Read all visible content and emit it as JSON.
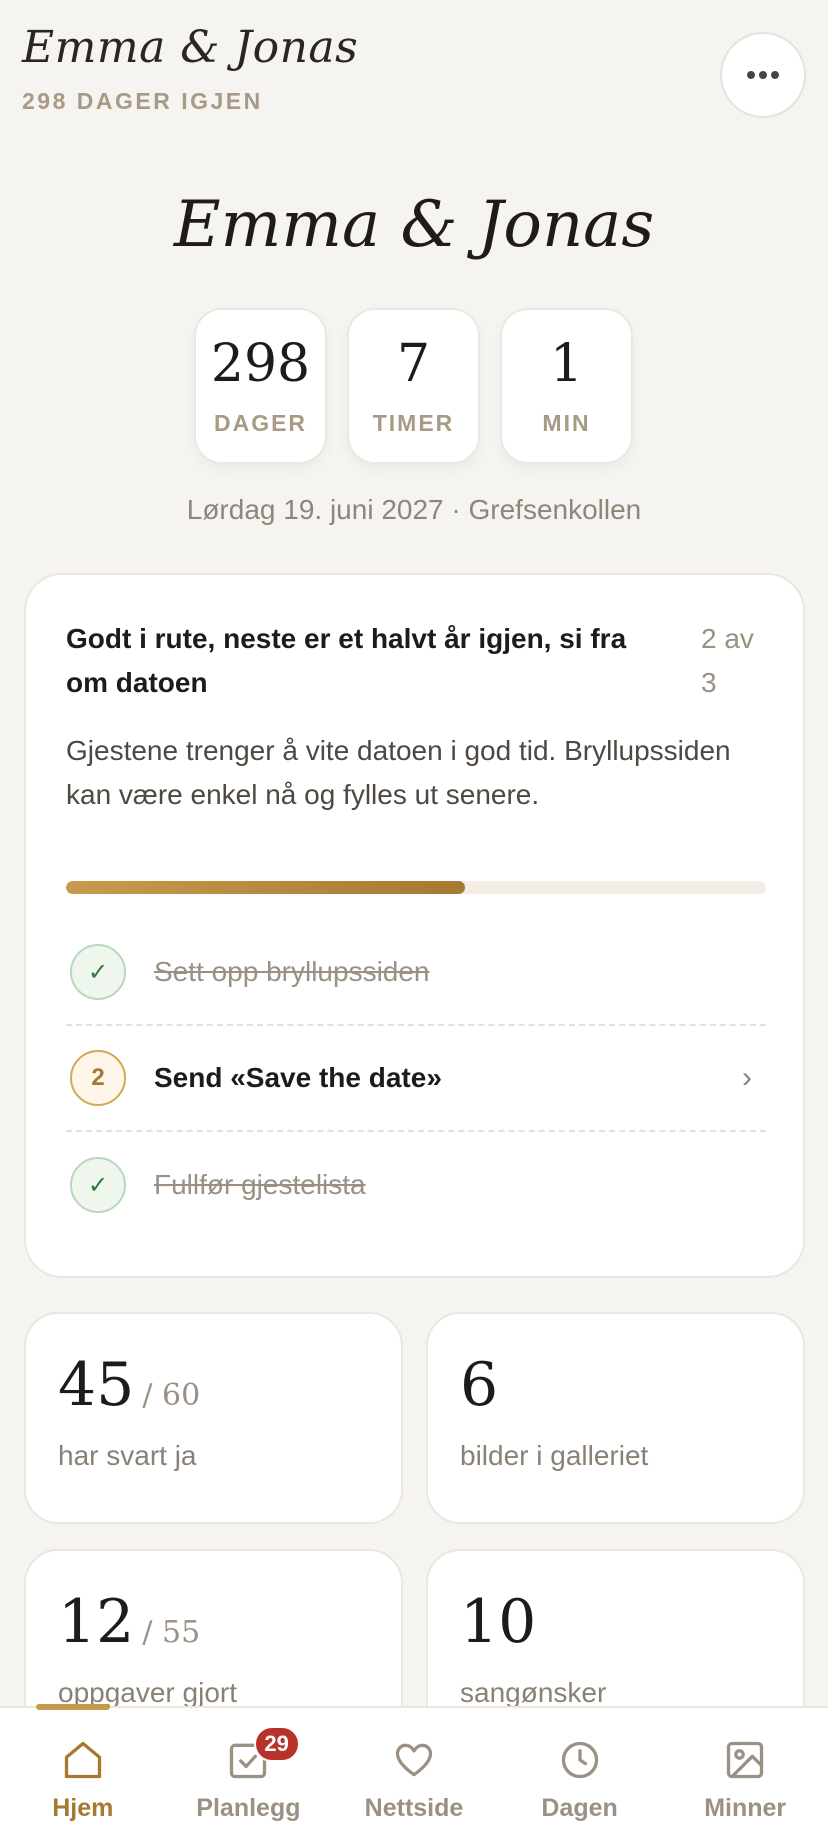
{
  "header": {
    "title": "Emma & Jonas",
    "countdown_text": "298 DAGER IGJEN"
  },
  "hero": {
    "names": "Emma & Jonas",
    "countdown": [
      {
        "value": "298",
        "label": "DAGER"
      },
      {
        "value": "7",
        "label": "TIMER"
      },
      {
        "value": "1",
        "label": "MIN"
      }
    ],
    "date_location": "Lørdag 19. juni 2027 · Grefsenkollen"
  },
  "progress_card": {
    "heading": "Godt i rute, neste er et halvt år igjen, si fra om datoen",
    "step": "2 av 3",
    "description": "Gjestene trenger å vite datoen i god tid. Bryllupssiden kan være enkel nå og fylles ut senere.",
    "progress": 0.57,
    "tasks": [
      {
        "marker": "✓",
        "label": "Sett opp bryllupssiden",
        "status": "done"
      },
      {
        "marker": "2",
        "label": "Send «Save the date»",
        "status": "active"
      },
      {
        "marker": "✓",
        "label": "Fullfør gjestelista",
        "status": "done"
      }
    ]
  },
  "stats": [
    {
      "value": "45",
      "total": "/ 60",
      "label": "har svart ja"
    },
    {
      "value": "6",
      "total": "",
      "label": "bilder i galleriet"
    },
    {
      "value": "12",
      "total": "/ 55",
      "label": "oppgaver gjort"
    },
    {
      "value": "10",
      "total": "",
      "label": "sangønsker"
    }
  ],
  "nav": {
    "items": [
      {
        "label": "Hjem",
        "icon": "home-icon",
        "active": true
      },
      {
        "label": "Planlegg",
        "icon": "checklist-icon",
        "badge": "29"
      },
      {
        "label": "Nettside",
        "icon": "heart-icon"
      },
      {
        "label": "Dagen",
        "icon": "clock-icon"
      },
      {
        "label": "Minner",
        "icon": "image-icon"
      }
    ]
  },
  "colors": {
    "accent": "#a57a30",
    "background": "#f6f4f1",
    "badge": "#b8322c",
    "success": "#2f7a36"
  }
}
